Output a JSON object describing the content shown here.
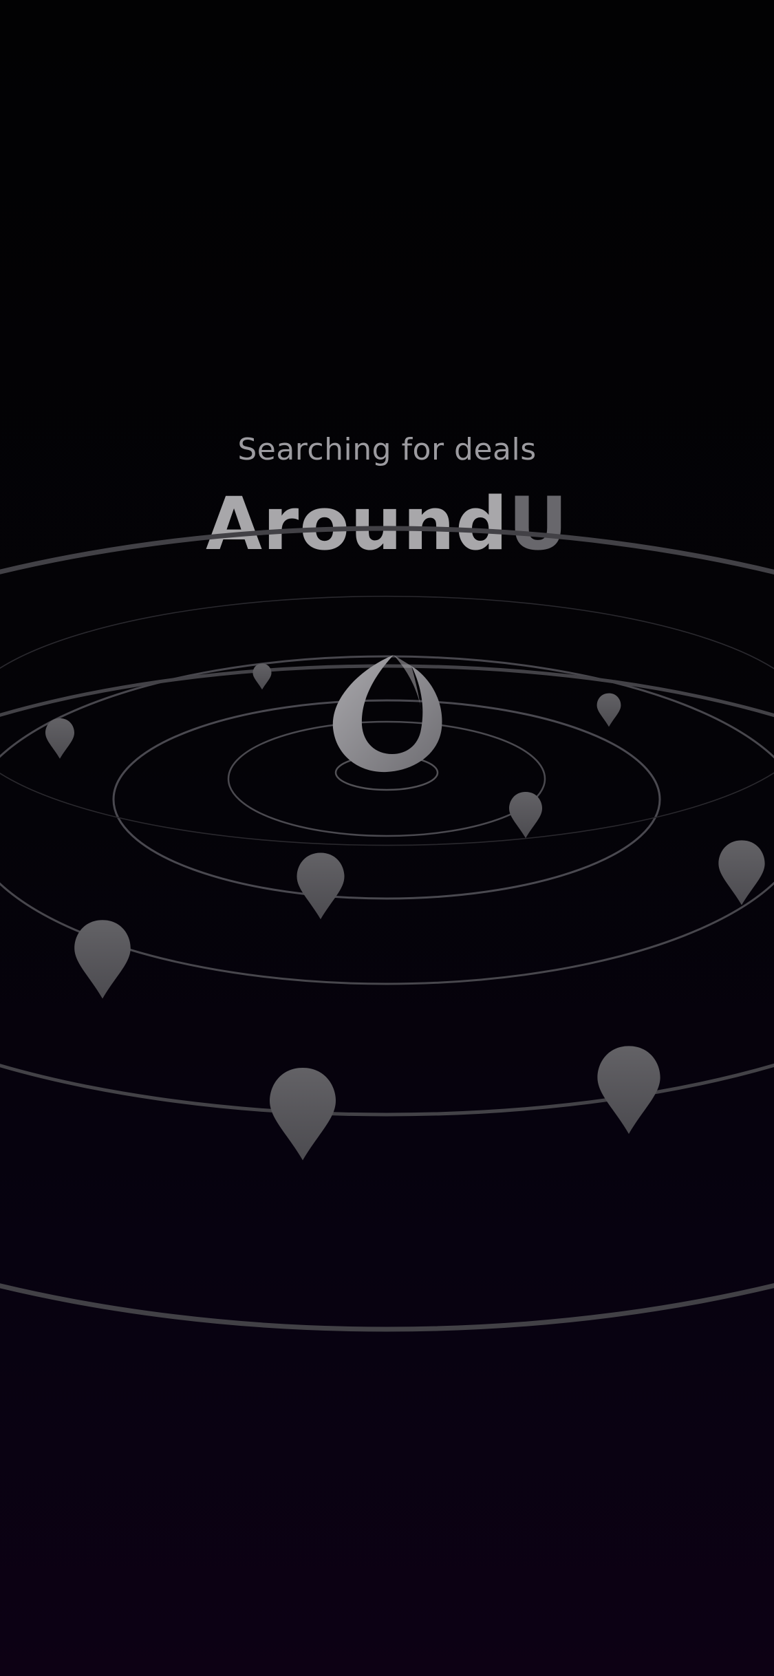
{
  "splash": {
    "subtitle": "Searching for deals",
    "brand_primary": "Around",
    "brand_accent": "U"
  },
  "colors": {
    "background_top": "#020203",
    "background_bottom": "#0d0114",
    "text_primary": "#a8a7aa",
    "text_accent": "#68676c",
    "ring_stroke": "#4a494e",
    "pin_fill": "#5a595d",
    "logo_fill": "#8d8c90"
  },
  "icons": {
    "logo": "aroundu-logo-icon",
    "pin": "map-pin-icon"
  }
}
